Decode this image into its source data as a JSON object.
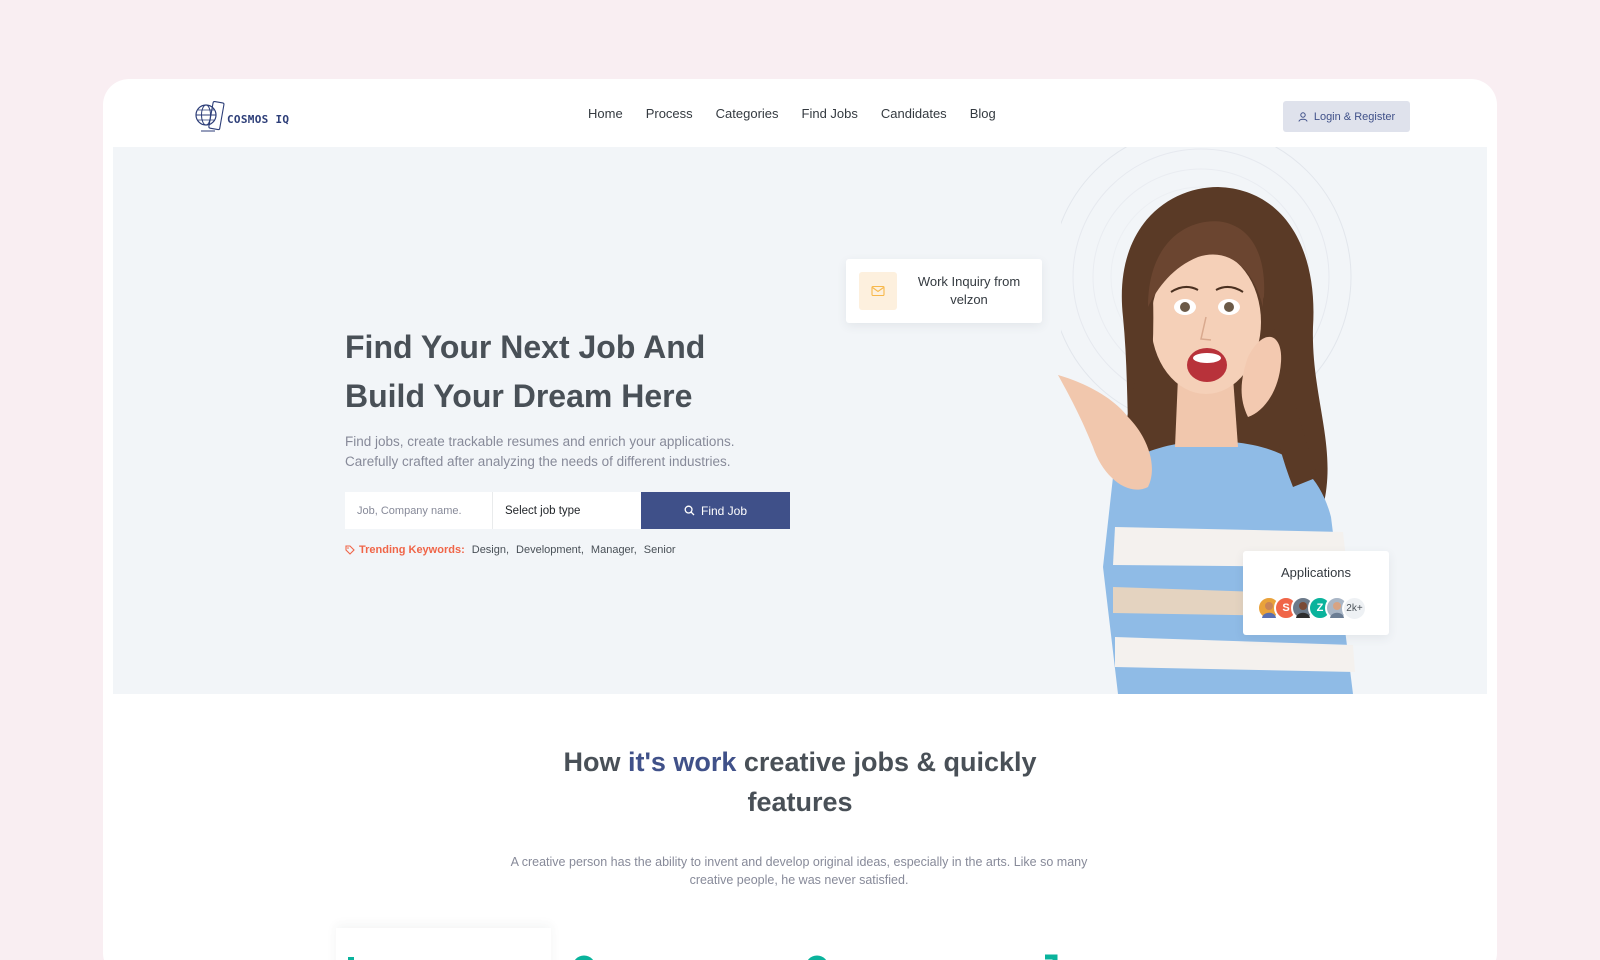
{
  "brand": {
    "name": "COSMOS IQ"
  },
  "nav": {
    "items": [
      "Home",
      "Process",
      "Categories",
      "Find Jobs",
      "Candidates",
      "Blog"
    ],
    "login_label": "Login & Register"
  },
  "hero": {
    "headline_line1": "Find Your Next Job And",
    "headline_line2": "Build Your Dream Here",
    "subtitle_line1": "Find jobs, create trackable resumes and enrich your applications.",
    "subtitle_line2": "Carefully crafted after analyzing the needs of different industries.",
    "search_placeholder": "Job, Company name.",
    "job_type_value": "Select job type",
    "find_button": "Find Job",
    "trending_label": "Trending Keywords:",
    "keywords": [
      "Design,",
      "Development,",
      "Manager,",
      "Senior"
    ]
  },
  "inquiry_card": {
    "line1": "Work Inquiry from",
    "line2": "velzon"
  },
  "applications_card": {
    "title": "Applications",
    "avatar_initials": [
      "S",
      "Z"
    ],
    "more_label": "2k+"
  },
  "colors": {
    "primary": "#405189",
    "accent_red": "#f06548",
    "success": "#0ab39c",
    "hero_bg": "#f2f5f8",
    "page_bg": "#f9eef2"
  },
  "features": {
    "title_pre": "How ",
    "title_highlight": "it's work",
    "title_post_line1": " creative jobs & quickly",
    "title_line2": "features",
    "subtitle": "A creative person has the ability to invent and develop original ideas, especially in the arts. Like so many creative people, he was never satisfied."
  },
  "icons": [
    "user-icon",
    "search-icon",
    "tag-icon",
    "mail-icon",
    "logo-globe-icon"
  ]
}
